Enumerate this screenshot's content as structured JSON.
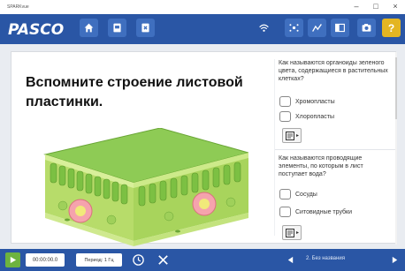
{
  "window": {
    "title": "SPARKvue"
  },
  "brand": {
    "logo_text": "PASCO"
  },
  "colors": {
    "toolbar": "#2a56a5",
    "accent_yellow": "#e3b522",
    "play_green": "#6db33f"
  },
  "toolbar": {
    "left_icons": [
      "home-icon",
      "journal-icon",
      "export-icon"
    ],
    "right_icons": [
      "wifi-icon",
      "sensor-icon",
      "tools-icon",
      "layout-icon",
      "camera-icon",
      "help-icon"
    ],
    "help_label": "?"
  },
  "page": {
    "heading": "Вспомните строение листовой пластинки."
  },
  "questions": [
    {
      "text": "Как называются органоиды зеленого цвета, содержащиеся в растительных клетках?",
      "options": [
        "Хромопласты",
        "Хлоропласты"
      ]
    },
    {
      "text": "Как называются проводящие элементы, по которым в лист поступает вода?",
      "options": [
        "Сосуды",
        "Ситовидные трубки"
      ]
    }
  ],
  "bottom": {
    "time": "00:00:00.0",
    "period": "Период: 1 Гц",
    "page_label": "2. Без названия"
  }
}
